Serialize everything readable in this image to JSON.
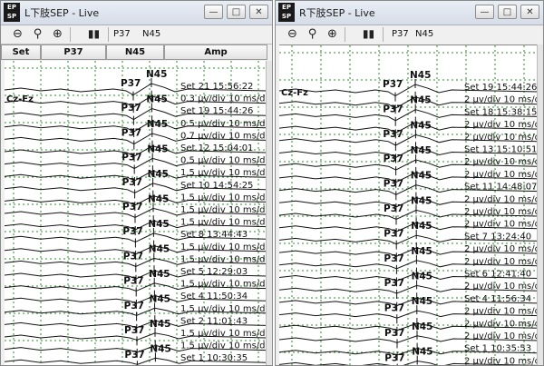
{
  "windows": [
    {
      "id": "left",
      "title": "L下肢SEP - Live",
      "toolbar": {
        "marker_labels": [
          "P37",
          "N45"
        ]
      },
      "columns": [
        "Set",
        "P37",
        "N45",
        "Amp"
      ],
      "channel_label": "Cz-Fz",
      "peak_labels": {
        "p": "P37",
        "n": "N45"
      },
      "trace_labels": [
        "Set 21 15:56:22",
        "0.3 μv/div 10 ms/div",
        "Set 19 15:44:26",
        "0.5 μv/div 10 ms/div",
        "0.7 μv/div 10 ms/div",
        "Set 12 15:04:01",
        "0.5 μv/div 10 ms/div",
        "1.5 μv/div 10 ms/div",
        "Set 10 14:54:25",
        "1.5 μv/div 10 ms/div",
        "1.5 μv/div 10 ms/div",
        "1.5 μv/div 10 ms/div",
        "Set 8 13:44:43",
        "1.5 μv/div 10 ms/div",
        "1.5 μv/div 10 ms/div",
        "Set 5 12:29:03",
        "1.5 μv/div 10 ms/div",
        "Set 4 11:50:34",
        "1.5 μv/div 10 ms/div",
        "Set 2 11:01:43",
        "1.5 μv/div 10 ms/div",
        "1.5 μv/div 10 ms/div",
        "Set 1 10:30:35"
      ]
    },
    {
      "id": "right",
      "title": "R下肢SEP - Live",
      "toolbar": {
        "marker_labels": [
          "P37",
          "N45"
        ]
      },
      "channel_label": "Cz-Fz",
      "peak_labels": {
        "p": "P37",
        "n": "N45"
      },
      "trace_labels": [
        "Set 19 15:44:26",
        "2 μv/div 10 ms/div",
        "Set 18 15:38:15",
        "2 μv/div 10 ms/div",
        "2 μv/div 10 ms/div",
        "Set 13 15:10:51",
        "2 μv/div 10 ms/div",
        "2 μv/div 10 ms/div",
        "Set 11 14:48:07",
        "2 μv/div 10 ms/div",
        "2 μv/div 10 ms/div",
        "2 μv/div 10 ms/div",
        "Set 7 13:24:40",
        "2 μv/div 10 ms/div",
        "2 μv/div 10 ms/div",
        "Set 6 12:41:40",
        "2 μv/div 10 ms/div",
        "Set 4 11:56:34",
        "2 μv/div 10 ms/div",
        "2 μv/div 10 ms/div",
        "2 μv/div 10 ms/div",
        "Set 1 10:35:53",
        "2 μv/div 10 ms/div"
      ]
    }
  ],
  "icons": {
    "app": "ep-app-icon",
    "toolbar": [
      "zoom-out-icon",
      "zoom-reset-icon",
      "zoom-in-icon",
      "bar-chart-icon"
    ],
    "window_controls": [
      "minimize-icon",
      "maximize-icon",
      "close-icon"
    ]
  },
  "colors": {
    "grid": "#2e8b2e",
    "trace": "#111111",
    "titlebar": "#dfe5ee"
  }
}
